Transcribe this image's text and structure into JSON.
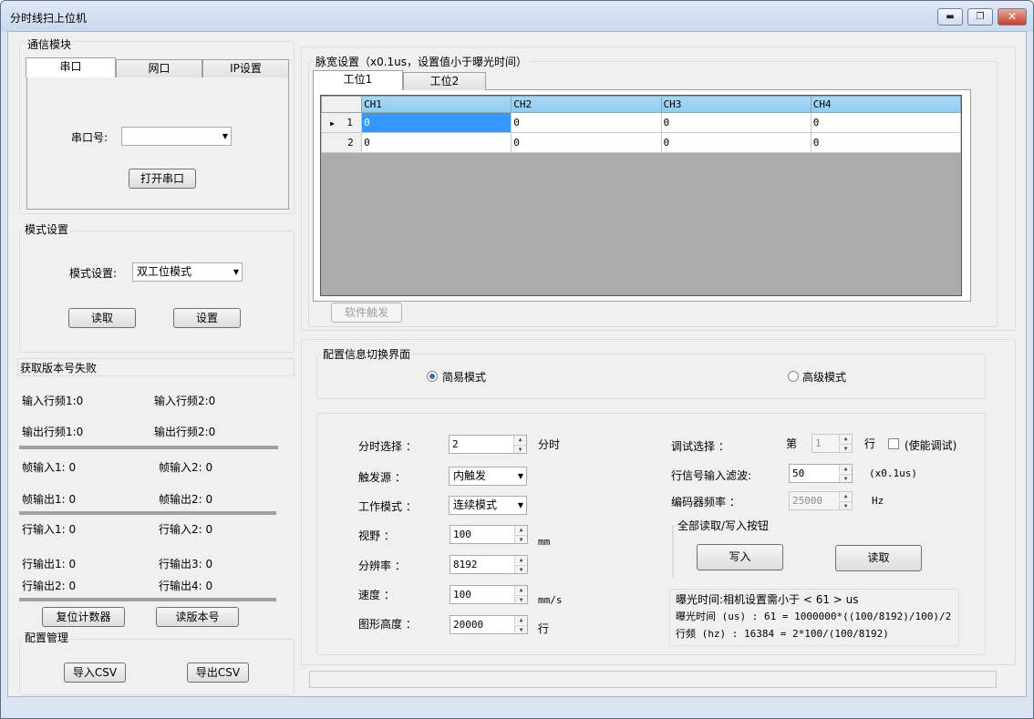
{
  "window": {
    "title": "分时线扫上位机",
    "min_label": "▬",
    "max_label": "❐",
    "close_label": "✕"
  },
  "comm": {
    "group_label": "通信模块",
    "tabs": [
      "串口",
      "网口",
      "IP设置"
    ],
    "port_label": "串口号:",
    "port_value": "",
    "open_label": "打开串口"
  },
  "mode": {
    "group_label": "模式设置",
    "label": "模式设置:",
    "value": "双工位模式",
    "read_label": "读取",
    "set_label": "设置"
  },
  "version_status": "获取版本号失败",
  "counters": {
    "in_freq1": "输入行频1:0",
    "in_freq2": "输入行频2:0",
    "out_freq1": "输出行频1:0",
    "out_freq2": "输出行频2:0",
    "frame_in1": "帧输入1: 0",
    "frame_in2": "帧输入2: 0",
    "frame_out1": "帧输出1: 0",
    "frame_out2": "帧输出2: 0",
    "line_in1": "行输入1: 0",
    "line_in2": "行输入2: 0",
    "line_out1": "行输出1: 0",
    "line_out3": "行输出3: 0",
    "line_out2": "行输出2: 0",
    "line_out4": "行输出4: 0"
  },
  "reset_label": "复位计数器",
  "read_version_label": "读版本号",
  "config": {
    "group_label": "配置管理",
    "import_label": "导入CSV",
    "export_label": "导出CSV"
  },
  "pulse": {
    "group_label": "脉宽设置（x0.1us，设置值小于曝光时间）",
    "tabs": [
      "工位1",
      "工位2"
    ],
    "columns": [
      "CH1",
      "CH2",
      "CH3",
      "CH4"
    ],
    "rows": [
      {
        "idx": "1",
        "vals": [
          "0",
          "0",
          "0",
          "0"
        ]
      },
      {
        "idx": "2",
        "vals": [
          "0",
          "0",
          "0",
          "0"
        ]
      }
    ],
    "soft_trigger_label": "软件触发"
  },
  "switch": {
    "group_label": "配置信息切换界面",
    "simple_label": "简易模式",
    "advanced_label": "高级模式"
  },
  "params": {
    "time_div_label": "分时选择  ：",
    "time_div_value": "2",
    "time_div_unit": "分时",
    "trigger_label": "触发源   ：",
    "trigger_value": "内触发",
    "work_mode_label": "工作模式  ：",
    "work_mode_value": "连续模式",
    "fov_label": "视野    ：",
    "fov_value": "100",
    "fov_unit": "mm",
    "resolution_label": "分辨率   ：",
    "resolution_value": "8192",
    "speed_label": "速度    ：",
    "speed_value": "100",
    "speed_unit": "mm/s",
    "height_label": "图形高度  ：",
    "height_value": "20000",
    "height_unit": "行",
    "debug_label": "调试选择    ：",
    "debug_prefix": "第",
    "debug_value": "1",
    "debug_suffix": "行",
    "debug_enable_label": "(使能调试)",
    "filter_label": "行信号输入滤波:",
    "filter_value": "50",
    "filter_unit": "(x0.1us)",
    "encoder_label": "编码器频率    ：",
    "encoder_value": "25000",
    "encoder_unit": "Hz",
    "rw_group_label": "全部读取/写入按钮",
    "write_label": "写入",
    "read_label": "读取",
    "exposure_note": "曝光时间:相机设置需小于  < 61 > us",
    "exposure_formula": "曝光时间 (us) : 61 = 1000000*((100/8192)/100)/2",
    "line_freq_formula": "行频 (hz)     : 16384 = 2*100/(100/8192)"
  }
}
